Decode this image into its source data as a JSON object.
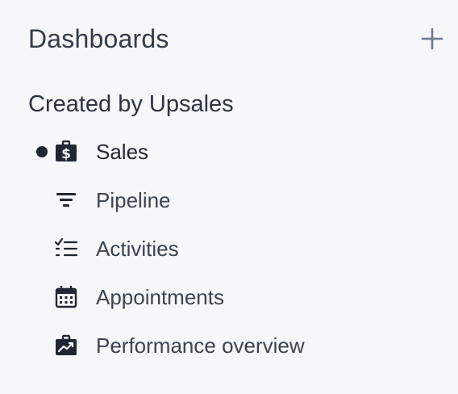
{
  "header": {
    "title": "Dashboards",
    "add_icon": "plus-icon"
  },
  "section": {
    "title": "Created by Upsales"
  },
  "items": [
    {
      "label": "Sales",
      "icon": "briefcase-dollar-icon",
      "active": true
    },
    {
      "label": "Pipeline",
      "icon": "funnel-icon",
      "active": false
    },
    {
      "label": "Activities",
      "icon": "checklist-icon",
      "active": false
    },
    {
      "label": "Appointments",
      "icon": "calendar-icon",
      "active": false
    },
    {
      "label": "Performance overview",
      "icon": "briefcase-chart-icon",
      "active": false
    }
  ],
  "colors": {
    "background": "#f6f7f9",
    "text": "#2b3440",
    "icon": "#1f2733",
    "add_icon": "#6b7a90"
  }
}
